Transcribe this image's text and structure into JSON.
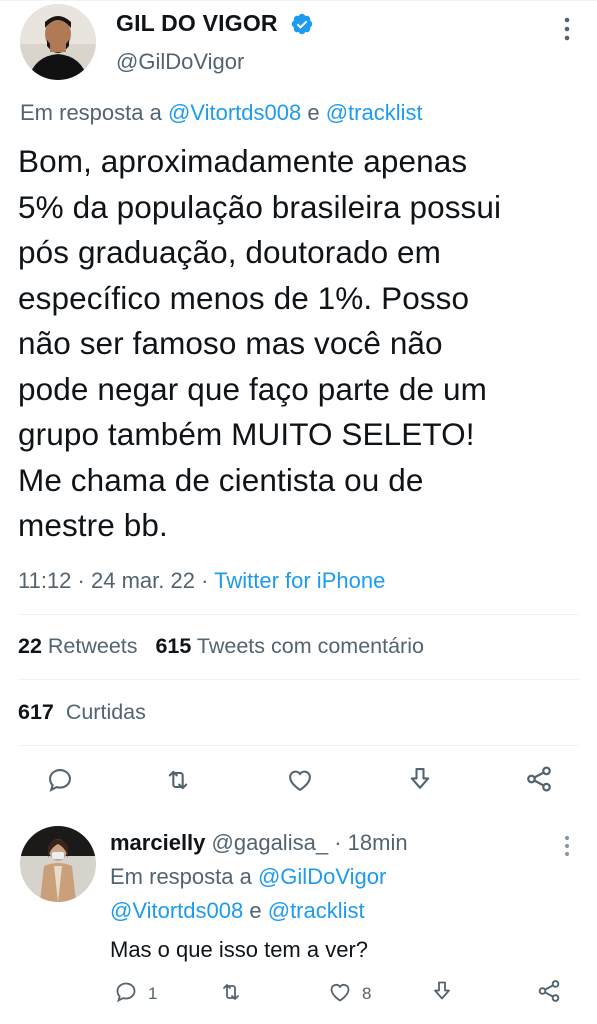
{
  "main_tweet": {
    "display_name": "GIL DO VIGOR",
    "handle": "@GilDoVigor",
    "reply_prefix": "Em resposta a",
    "reply_to_1": "@Vitortds008",
    "reply_conj": "e",
    "reply_to_2": "@tracklist",
    "text": "Bom, aproximadamente apenas\n5% da população brasileira possui\npós graduação, doutorado em\nespecífico menos de 1%. Posso\nnão ser famoso mas você não\npode negar que faço parte de um\ngrupo também MUITO SELETO!\nMe chama de cientista ou de\nmestre bb.",
    "time": "11:12",
    "date": "24 mar. 22",
    "separator": "·",
    "source": "Twitter for iPhone",
    "retweets_count": "22",
    "retweets_label": "Retweets",
    "quotes_count": "615",
    "quotes_label": "Tweets com comentário",
    "likes_count": "617",
    "likes_label": "Curtidas"
  },
  "reply_tweet": {
    "display_name": "marcielly",
    "handle": "@gagalisa_",
    "separator": "·",
    "time_ago": "18min",
    "reply_prefix": "Em resposta a",
    "reply_to_1": "@GilDoVigor",
    "reply_to_2": "@Vitortds008",
    "reply_conj": "e",
    "reply_to_3": "@tracklist",
    "text": "Mas o que isso tem a ver?",
    "reply_count": "1",
    "like_count": "8"
  },
  "colors": {
    "accent": "#1d9bf0",
    "secondary_text": "#536471",
    "primary_text": "#0f1419",
    "divider": "#eff3f4"
  },
  "icons": [
    "verified-badge-icon",
    "more-icon",
    "reply-icon",
    "retweet-icon",
    "like-icon",
    "share-icon",
    "upload-icon"
  ]
}
